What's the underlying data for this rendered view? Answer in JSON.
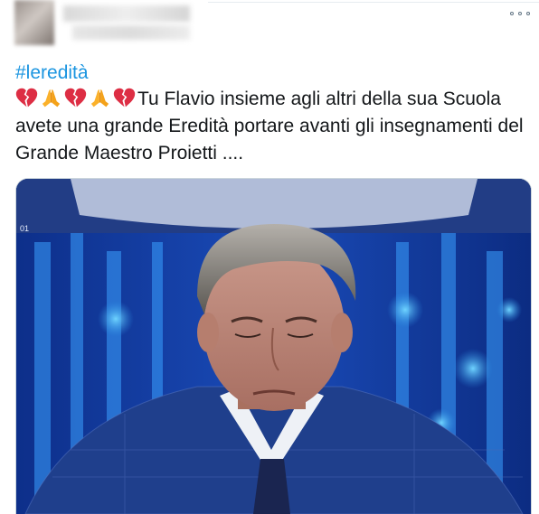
{
  "tweet": {
    "hashtag": "#leredità",
    "text": "Tu Flavio insieme agli altri della sua Scuola avete una grande Eredità portare avanti gli insegnamenti del Grande Maestro Proietti ....",
    "emoji_sequence": [
      "broken-heart",
      "folded-hands",
      "broken-heart",
      "folded-hands",
      "broken-heart"
    ],
    "media": {
      "overlay_text": "01",
      "colors": {
        "background": "#123a9a",
        "light_blue": "#2a8be0",
        "suit": "#1f3f8c",
        "hair": "#8c8a86"
      }
    }
  },
  "header": {
    "more_label": "More options"
  },
  "colors": {
    "hashtag": "#1b95e0",
    "text": "#14171a",
    "border": "#ccd6dd"
  }
}
